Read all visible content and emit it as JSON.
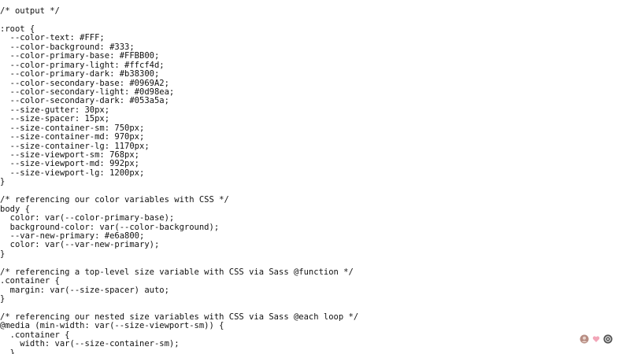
{
  "editor": {
    "lines": [
      "/* output */",
      "",
      ":root {",
      "  --color-text: #FFF;",
      "  --color-background: #333;",
      "  --color-primary-base: #FFBB00;",
      "  --color-primary-light: #ffcf4d;",
      "  --color-primary-dark: #b38300;",
      "  --color-secondary-base: #0969A2;",
      "  --color-secondary-light: #0d98ea;",
      "  --color-secondary-dark: #053a5a;",
      "  --size-gutter: 30px;",
      "  --size-spacer: 15px;",
      "  --size-container-sm: 750px;",
      "  --size-container-md: 970px;",
      "  --size-container-lg: 1170px;",
      "  --size-viewport-sm: 768px;",
      "  --size-viewport-md: 992px;",
      "  --size-viewport-lg: 1200px;",
      "}",
      "",
      "/* referencing our color variables with CSS */",
      "body {",
      "  color: var(--color-primary-base);",
      "  background-color: var(--color-background);",
      "  --var-new-primary: #e6a800;",
      "  color: var(--var-new-primary);",
      "}",
      "",
      "/* referencing a top-level size variable with CSS via Sass @function */",
      ".container {",
      "  margin: var(--size-spacer) auto;",
      "}",
      "",
      "/* referencing our nested size variables with CSS via Sass @each loop */",
      "@media (min-width: var(--size-viewport-sm)) {",
      "  .container {",
      "    width: var(--size-container-sm);",
      "  }"
    ]
  },
  "toolbar": {
    "icons": [
      "avatar-icon",
      "heart-icon",
      "settings-icon"
    ]
  },
  "colors": {
    "text": "#111111",
    "background": "#ffffff",
    "heart": "#f2a6b8",
    "avatar": "#b78d83",
    "settings": "#555555"
  }
}
